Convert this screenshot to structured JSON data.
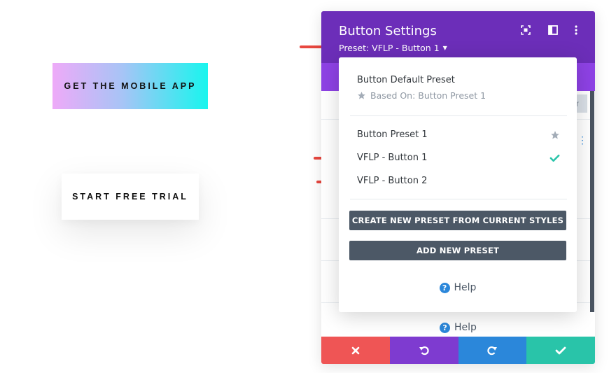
{
  "demo": {
    "mobile_button_label": "GET THE MOBILE APP",
    "trial_button_label": "START FREE TRIAL"
  },
  "modal": {
    "title": "Button Settings",
    "preset_label": "Preset: VFLP - Button 1",
    "hint_fragment": "r",
    "help_label": "Help",
    "header_icons": [
      "expand-icon",
      "sidebar-layout-icon",
      "more-vertical-icon"
    ],
    "footer_icons": [
      "close-icon",
      "undo-icon",
      "redo-icon",
      "check-icon"
    ]
  },
  "dropdown": {
    "default_title": "Button Default Preset",
    "based_on": "Based On: Button Preset 1",
    "items": [
      {
        "label": "Button Preset 1",
        "icon": "star-icon"
      },
      {
        "label": "VFLP - Button 1",
        "icon": "check-icon"
      },
      {
        "label": "VFLP - Button 2",
        "icon": ""
      }
    ],
    "create_button": "CREATE NEW PRESET FROM CURRENT STYLES",
    "add_button": "ADD NEW PRESET",
    "help_label": "Help"
  },
  "colors": {
    "header_purple": "#6c2eb9",
    "tab_purple": "#8e42e5",
    "cancel_red": "#ef5555",
    "undo_purple": "#7e3bd0",
    "redo_blue": "#2b87da",
    "save_green": "#29c4a9",
    "arrow_red": "#e8473f",
    "check_green": "#29c4a9",
    "star_gray": "#a3acb7"
  }
}
